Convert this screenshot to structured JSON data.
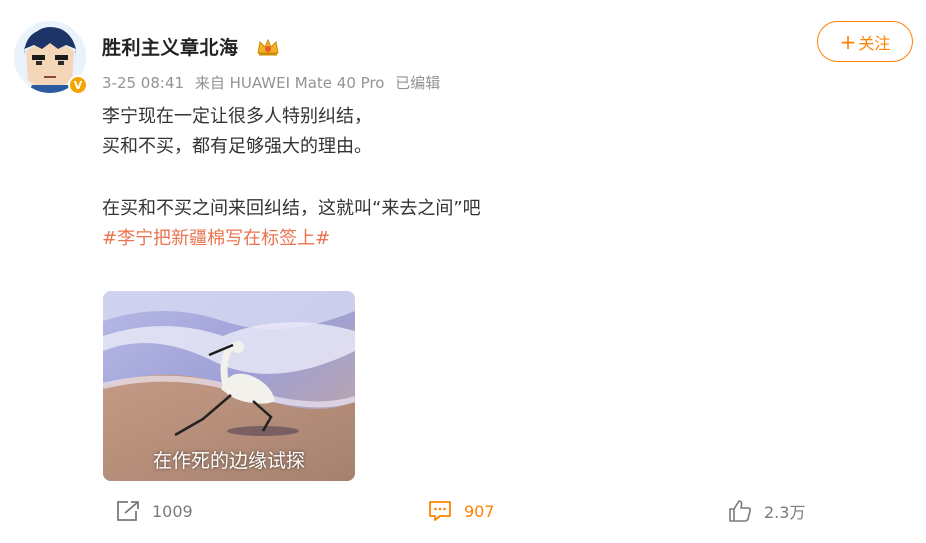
{
  "post": {
    "username": "胜利主义章北海",
    "crown_icon": "crown-badge-icon",
    "verified_icon": "v-badge-icon",
    "date": "3-25 08:41",
    "source": "来自 HUAWEI Mate 40 Pro",
    "edited": "已编辑",
    "follow_label": "关注",
    "text_lines": [
      "李宁现在一定让很多人特别纠结，",
      "买和不买，都有足够强大的理由。"
    ],
    "text_line_3": "在买和不买之间来回纠结，这就叫“来去之间”吧",
    "hashtag": "#李宁把新疆棉写在标签上#",
    "image_caption": "在作死的边缘试探"
  },
  "actions": {
    "repost_count": "1009",
    "comment_count": "907",
    "like_count": "2.3万"
  },
  "colors": {
    "accent": "#ff8200",
    "hashtag": "#eb7350",
    "meta_text": "#939393"
  }
}
